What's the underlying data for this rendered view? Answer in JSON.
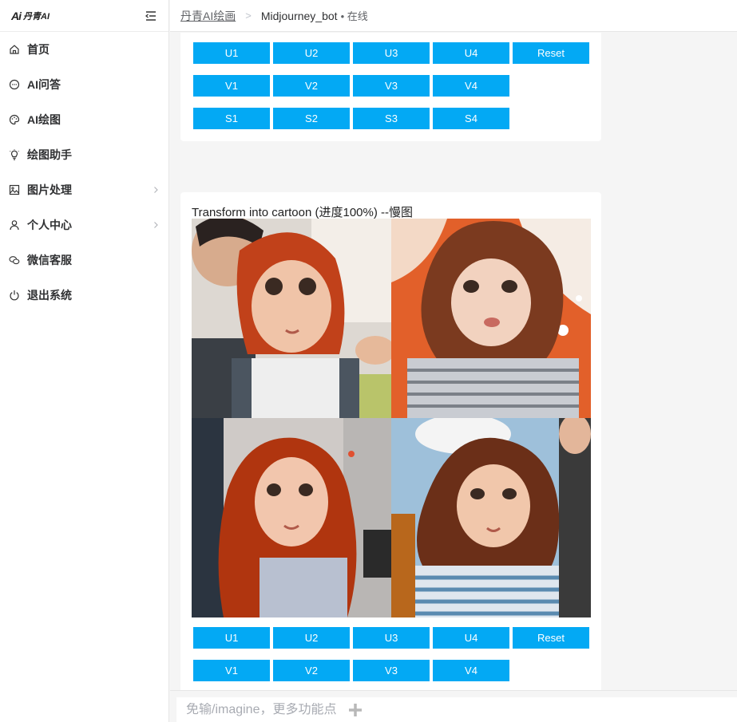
{
  "brand": {
    "mark": "Ai",
    "name": "丹青AI"
  },
  "sidebar": {
    "items": [
      {
        "label": "首页",
        "icon": "home-icon"
      },
      {
        "label": "AI问答",
        "icon": "chat-bubble-icon"
      },
      {
        "label": "AI绘图",
        "icon": "palette-icon"
      },
      {
        "label": "绘图助手",
        "icon": "lightbulb-icon"
      },
      {
        "label": "图片处理",
        "icon": "image-icon"
      },
      {
        "label": "个人中心",
        "icon": "user-icon"
      },
      {
        "label": "微信客服",
        "icon": "wechat-icon"
      },
      {
        "label": "退出系统",
        "icon": "power-icon"
      }
    ]
  },
  "header": {
    "breadcrumb_link": "丹青AI绘画",
    "breadcrumb_separator": ">",
    "current": "Midjourney_bot",
    "status": "• 在线"
  },
  "card1": {
    "row1": [
      "U1",
      "U2",
      "U3",
      "U4",
      "Reset"
    ],
    "row2": [
      "V1",
      "V2",
      "V3",
      "V4"
    ],
    "row3": [
      "S1",
      "S2",
      "S3",
      "S4"
    ]
  },
  "card2": {
    "title": "Transform into cartoon (进度100%) --慢图",
    "row1": [
      "U1",
      "U2",
      "U3",
      "U4",
      "Reset"
    ],
    "row2": [
      "V1",
      "V2",
      "V3",
      "V4"
    ]
  },
  "input": {
    "placeholder": "免输/imagine，更多功能点"
  },
  "colors": {
    "button": "#03a9f4",
    "sidebar_bg": "#ffffff",
    "content_bg": "#f5f5f5"
  }
}
